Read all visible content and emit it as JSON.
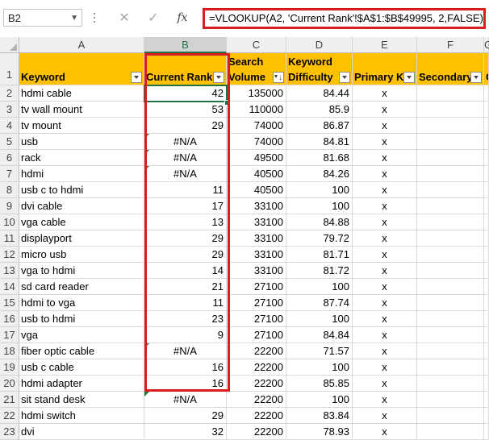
{
  "name_box": "B2",
  "formula": "=VLOOKUP(A2, 'Current Rank'!$A$1:$B$49995, 2,FALSE)",
  "icons": [
    "cancel-icon",
    "enter-icon",
    "insert-function-icon"
  ],
  "fx_label": "fx",
  "columns": [
    "A",
    "B",
    "C",
    "D",
    "E",
    "F",
    "G"
  ],
  "header_row": {
    "row_number": "1",
    "a": "Keyword",
    "b": "Current Rank",
    "c_top": "Search",
    "c_bottom": "Volume",
    "d_top": "Keyword",
    "d_bottom": "Difficulty",
    "e": "Primary K",
    "f": "Secondary",
    "g": "C"
  },
  "rows": [
    {
      "row": "2",
      "keyword": "hdmi cable",
      "rank": "42",
      "volume": "135000",
      "difficulty": "84.44",
      "primary": "x"
    },
    {
      "row": "3",
      "keyword": "tv wall mount",
      "rank": "53",
      "volume": "110000",
      "difficulty": "85.9",
      "primary": "x"
    },
    {
      "row": "4",
      "keyword": "tv mount",
      "rank": "29",
      "volume": "74000",
      "difficulty": "86.87",
      "primary": "x"
    },
    {
      "row": "5",
      "keyword": "usb",
      "rank": "#N/A",
      "volume": "74000",
      "difficulty": "84.81",
      "primary": "x"
    },
    {
      "row": "6",
      "keyword": "rack",
      "rank": "#N/A",
      "volume": "49500",
      "difficulty": "81.68",
      "primary": "x"
    },
    {
      "row": "7",
      "keyword": "hdmi",
      "rank": "#N/A",
      "volume": "40500",
      "difficulty": "84.26",
      "primary": "x"
    },
    {
      "row": "8",
      "keyword": "usb c to hdmi",
      "rank": "11",
      "volume": "40500",
      "difficulty": "100",
      "primary": "x"
    },
    {
      "row": "9",
      "keyword": "dvi cable",
      "rank": "17",
      "volume": "33100",
      "difficulty": "100",
      "primary": "x"
    },
    {
      "row": "10",
      "keyword": "vga cable",
      "rank": "13",
      "volume": "33100",
      "difficulty": "84.88",
      "primary": "x"
    },
    {
      "row": "11",
      "keyword": "displayport",
      "rank": "29",
      "volume": "33100",
      "difficulty": "79.72",
      "primary": "x"
    },
    {
      "row": "12",
      "keyword": "micro usb",
      "rank": "29",
      "volume": "33100",
      "difficulty": "81.71",
      "primary": "x"
    },
    {
      "row": "13",
      "keyword": "vga to hdmi",
      "rank": "14",
      "volume": "33100",
      "difficulty": "81.72",
      "primary": "x"
    },
    {
      "row": "14",
      "keyword": "sd card reader",
      "rank": "21",
      "volume": "27100",
      "difficulty": "100",
      "primary": "x"
    },
    {
      "row": "15",
      "keyword": "hdmi to vga",
      "rank": "11",
      "volume": "27100",
      "difficulty": "87.74",
      "primary": "x"
    },
    {
      "row": "16",
      "keyword": "usb to hdmi",
      "rank": "23",
      "volume": "27100",
      "difficulty": "100",
      "primary": "x"
    },
    {
      "row": "17",
      "keyword": "vga",
      "rank": "9",
      "volume": "27100",
      "difficulty": "84.84",
      "primary": "x"
    },
    {
      "row": "18",
      "keyword": "fiber optic cable",
      "rank": "#N/A",
      "volume": "22200",
      "difficulty": "71.57",
      "primary": "x"
    },
    {
      "row": "19",
      "keyword": "usb c cable",
      "rank": "16",
      "volume": "22200",
      "difficulty": "100",
      "primary": "x"
    },
    {
      "row": "20",
      "keyword": "hdmi adapter",
      "rank": "16",
      "volume": "22200",
      "difficulty": "85.85",
      "primary": "x"
    },
    {
      "row": "21",
      "keyword": "sit stand desk",
      "rank": "#N/A",
      "volume": "22200",
      "difficulty": "100",
      "primary": "x"
    },
    {
      "row": "22",
      "keyword": "hdmi switch",
      "rank": "29",
      "volume": "22200",
      "difficulty": "83.84",
      "primary": "x"
    },
    {
      "row": "23",
      "keyword": "dvi",
      "rank": "32",
      "volume": "22200",
      "difficulty": "78.93",
      "primary": "x"
    }
  ],
  "colors": {
    "header_fill": "#ffc000",
    "highlight": "#d81e1e",
    "selection": "#217346"
  }
}
